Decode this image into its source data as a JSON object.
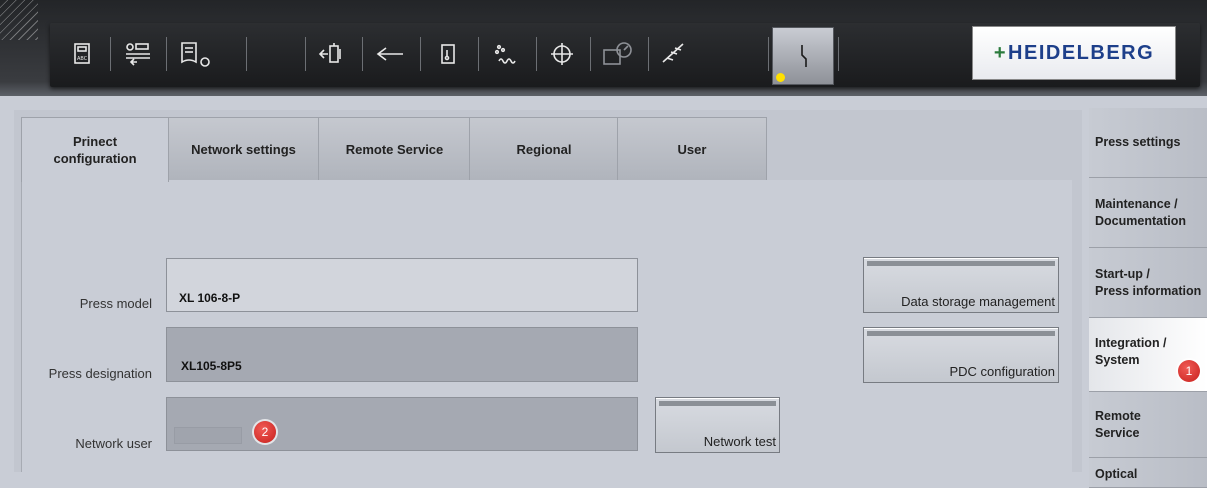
{
  "header": {
    "logo": "HEIDELBERG",
    "tools": [
      {
        "icon": "sd-card-icon"
      },
      {
        "icon": "data-transfer-icon"
      },
      {
        "icon": "job-document-icon"
      },
      {
        "icon": "feeder-icon"
      },
      {
        "icon": "arrow-left-icon"
      },
      {
        "icon": "inking-unit-icon"
      },
      {
        "icon": "dampening-icon"
      },
      {
        "icon": "register-crosshair-icon"
      },
      {
        "icon": "color-measurement-icon"
      },
      {
        "icon": "delivery-icon"
      }
    ],
    "active_tool": {
      "icon": "system-icon"
    }
  },
  "tabs": [
    {
      "label": "Prinect configuration",
      "active": true
    },
    {
      "label": "Network settings"
    },
    {
      "label": "Remote Service"
    },
    {
      "label": "Regional"
    },
    {
      "label": "User"
    }
  ],
  "form": {
    "press_model": {
      "label": "Press model",
      "value": "XL 106-8-P"
    },
    "press_designation": {
      "label": "Press designation",
      "value": "XL105-8P5"
    },
    "network_user": {
      "label": "Network user",
      "value": ""
    },
    "buttons": {
      "data_storage": "Data storage management",
      "pdc": "PDC configuration",
      "network_test": "Network test"
    }
  },
  "sidebar": {
    "items": [
      {
        "label": "Press settings"
      },
      {
        "label": "Maintenance / Documentation",
        "line1": "Maintenance /",
        "line2": "Documentation"
      },
      {
        "label": "Start-up / Press information",
        "line1": "Start-up /",
        "line2": "Press information"
      },
      {
        "label": "Integration / System",
        "line1": "Integration /",
        "line2": "System",
        "active": true
      },
      {
        "label": "Remote Service",
        "line1": "Remote",
        "line2": "Service"
      },
      {
        "label": "Optical"
      }
    ]
  },
  "badges": {
    "one": "1",
    "two": "2"
  },
  "colors": {
    "brand_blue": "#1d3f8a",
    "badge_red": "#d0241f",
    "indicator_yellow": "#ffe000"
  }
}
